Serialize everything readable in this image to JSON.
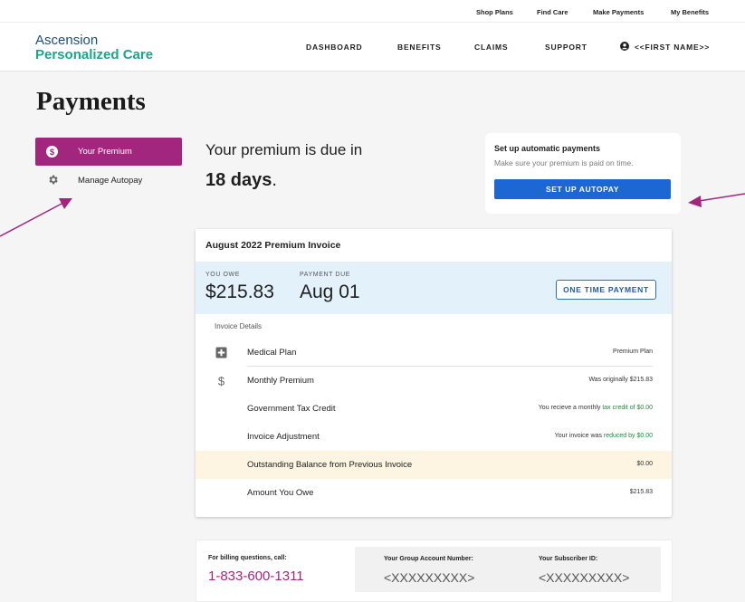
{
  "utility_nav": [
    "Shop Plans",
    "Find Care",
    "Make Payments",
    "My Benefits"
  ],
  "brand": {
    "line1": "Ascension",
    "line2": "Personalized Care"
  },
  "main_nav": [
    "DASHBOARD",
    "BENEFITS",
    "CLAIMS",
    "SUPPORT"
  ],
  "user": {
    "name": "<<FIRST NAME>>",
    "icon": "user-circle-icon"
  },
  "page_title": "Payments",
  "sidebar": {
    "items": [
      {
        "label": "Your Premium",
        "icon": "dollar-circle-icon",
        "active": true
      },
      {
        "label": "Manage Autopay",
        "icon": "gear-icon",
        "active": false
      }
    ]
  },
  "due": {
    "line": "Your premium is due in",
    "days": "18 days",
    "suffix": "."
  },
  "autopay": {
    "title": "Set up automatic payments",
    "subtitle": "Make sure your premium is paid on time.",
    "button": "SET UP AUTOPAY"
  },
  "invoice": {
    "title": "August 2022 Premium Invoice",
    "owe_label": "YOU OWE",
    "owe_value": "$215.83",
    "due_label": "PAYMENT DUE",
    "due_value": "Aug 01",
    "one_time_button": "ONE TIME PAYMENT",
    "details_title": "Invoice Details",
    "rows": [
      {
        "label": "Medical Plan",
        "value": "Premium Plan",
        "icon": "plus-square-icon"
      },
      {
        "label": "Monthly Premium",
        "value": "Was originally $215.83",
        "icon": "dollar-icon"
      },
      {
        "label": "Government Tax Credit",
        "value_prefix": "You recieve a monthly ",
        "value_green": "tax credit of $0.00"
      },
      {
        "label": "Invoice Adjustment",
        "value_prefix": "Your invoice was ",
        "value_green": "reduced by $0.00"
      },
      {
        "label": "Outstanding Balance from Previous Invoice",
        "value": "$0.00",
        "highlight": true
      },
      {
        "label": "Amount You Owe",
        "value": "$215.83"
      }
    ]
  },
  "billing": {
    "call_label": "For billing questions, call:",
    "phone": "1-833-600-1311",
    "group_label": "Your Group Account Number:",
    "group_value": "<XXXXXXXXX>",
    "subscriber_label": "Your Subscriber ID:",
    "subscriber_value": "<XXXXXXXXX>"
  },
  "colors": {
    "accent": "#a3267e",
    "primary_button": "#1d67d4",
    "brand_teal": "#1aa68b",
    "brand_blue": "#1c4e7a",
    "owe_band": "#e3f1fb",
    "highlight_row": "#fdf4e1",
    "credit_green": "#1f8a3a"
  }
}
